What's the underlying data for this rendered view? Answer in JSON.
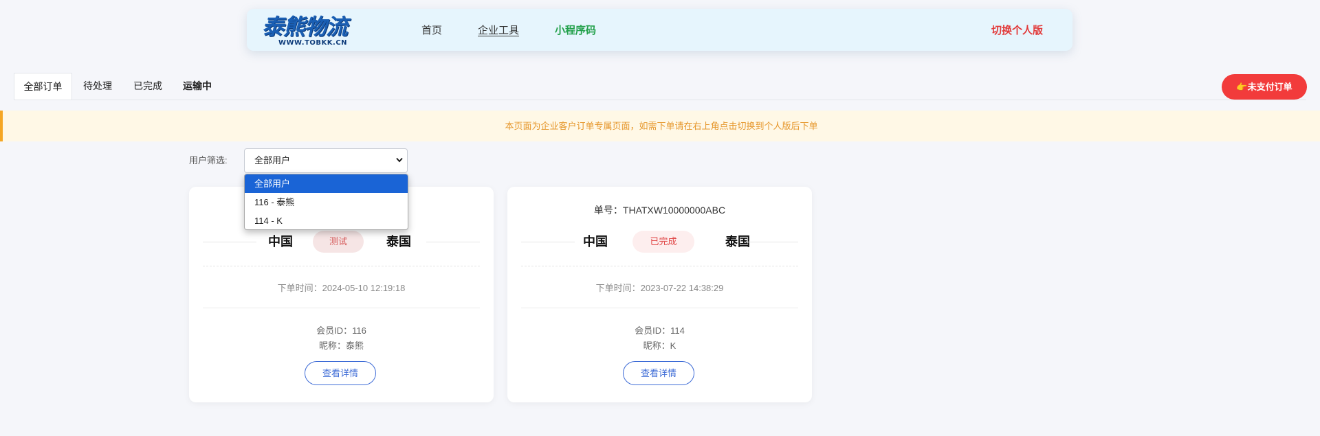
{
  "header": {
    "logo_main": "泰熊物流",
    "logo_sub": "WWW.TOBKK.CN",
    "nav": {
      "home": "首页",
      "tools": "企业工具",
      "qr": "小程序码",
      "switch": "切换个人版"
    }
  },
  "tabs": {
    "all": "全部订单",
    "pending": "待处理",
    "done": "已完成",
    "transit": "运输中"
  },
  "unpaid_button": "👉未支付订单",
  "notice": "本页面为企业客户订单专属页面，如需下单请在右上角点击切换到个人版后下单",
  "filter": {
    "label": "用户筛选:",
    "selected": "全部用户",
    "options": [
      "全部用户",
      "116 - 泰熊",
      "114 - K"
    ]
  },
  "orders": [
    {
      "order_no": "",
      "from": "中国",
      "to": "泰国",
      "status": "测试",
      "time": "下单时间：2024-05-10 12:19:18",
      "member_id": "会员ID：116",
      "nickname": "昵称：泰熊",
      "detail_label": "查看详情"
    },
    {
      "order_no": "单号：THATXW10000000ABC",
      "from": "中国",
      "to": "泰国",
      "status": "已完成",
      "time": "下单时间：2023-07-22 14:38:29",
      "member_id": "会员ID：114",
      "nickname": "昵称：K",
      "detail_label": "查看详情"
    }
  ],
  "colors": {
    "accent": "#1a5fb4",
    "danger": "#f23b3b",
    "success": "#22a04a",
    "notice": "#e6962a"
  }
}
